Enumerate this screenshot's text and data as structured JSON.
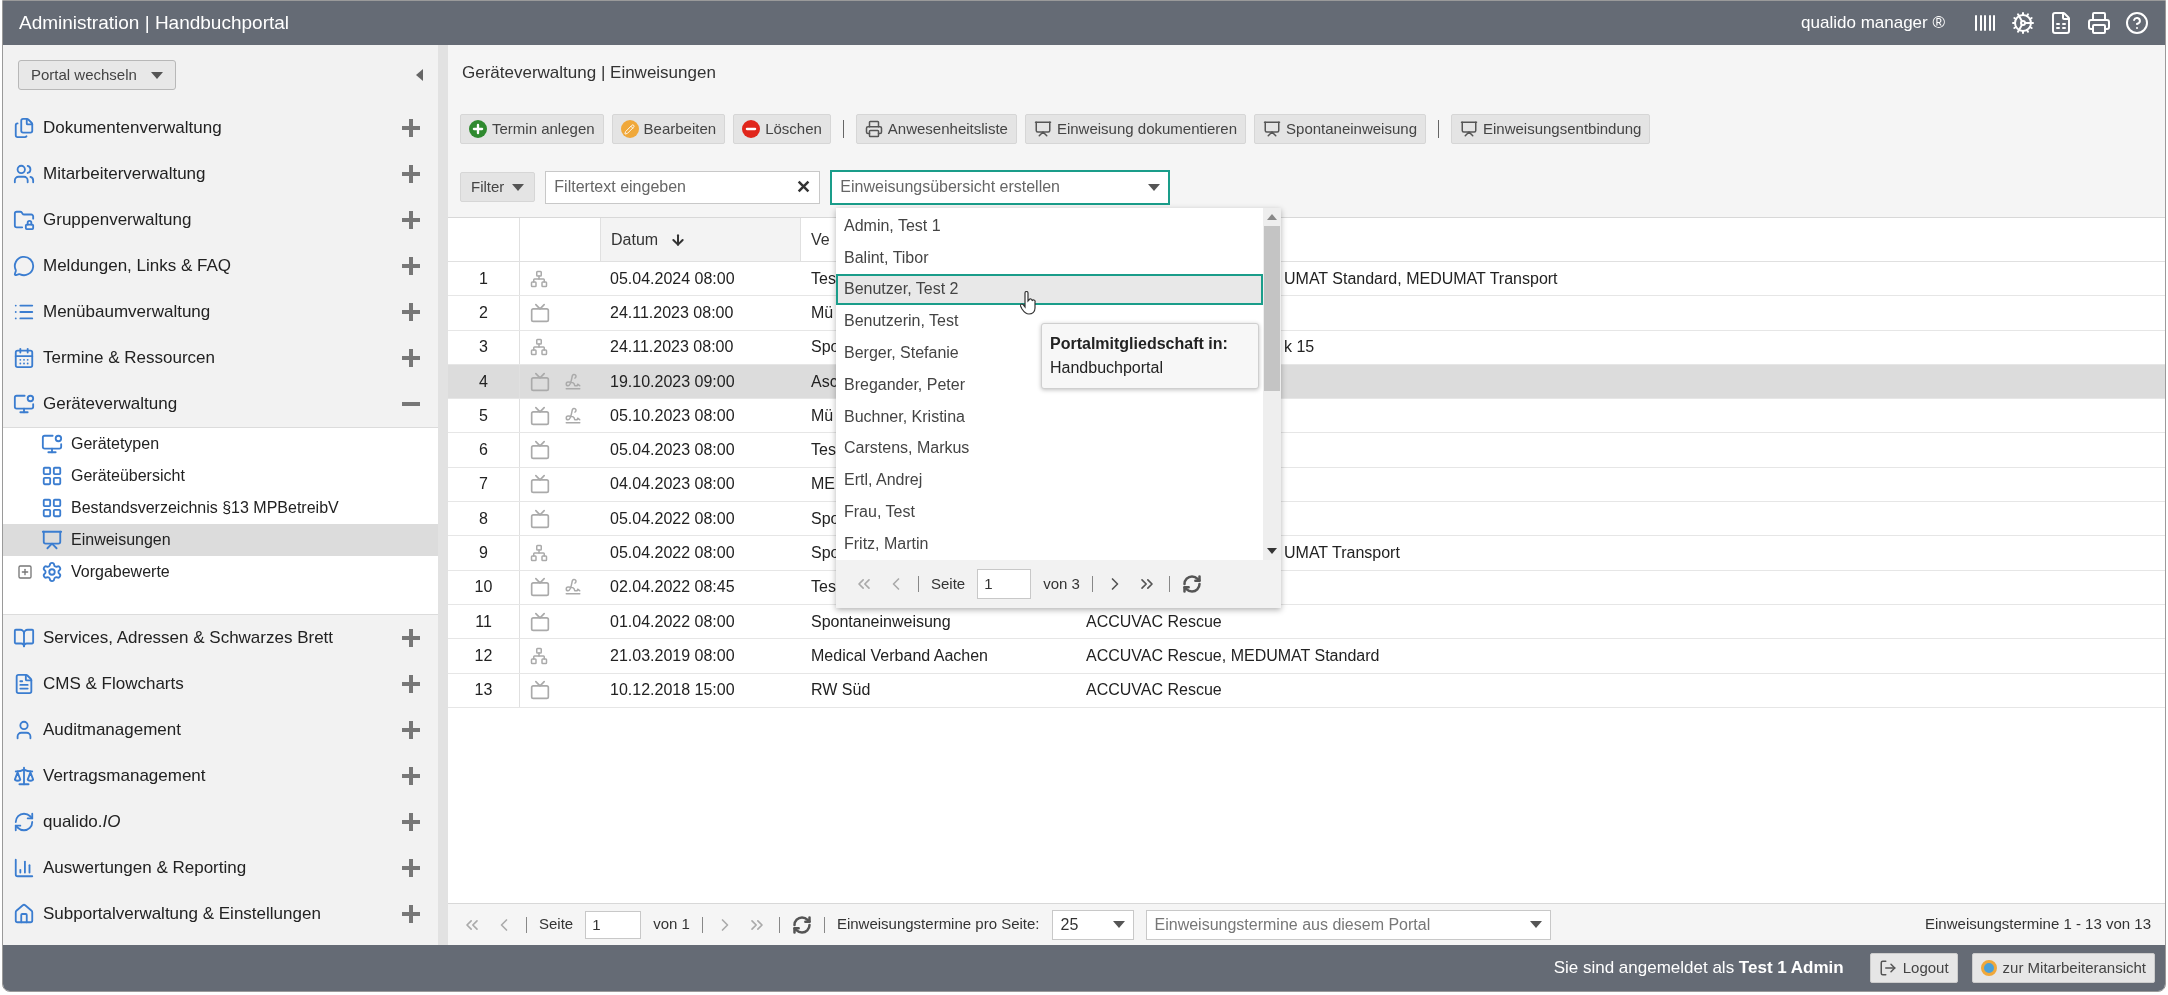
{
  "header": {
    "title": "Administration | Handbuchportal",
    "product": "qualido manager ®"
  },
  "sidebar": {
    "portal_switch": "Portal wechseln",
    "sections_top": [
      {
        "label": "Dokumentenverwaltung",
        "expanded": false
      },
      {
        "label": "Mitarbeiterverwaltung",
        "expanded": false
      },
      {
        "label": "Gruppenverwaltung",
        "expanded": false
      },
      {
        "label": "Meldungen, Links & FAQ",
        "expanded": false
      },
      {
        "label": "Menübaumverwaltung",
        "expanded": false
      },
      {
        "label": "Termine & Ressourcen",
        "expanded": false
      },
      {
        "label": "Geräteverwaltung",
        "expanded": true,
        "children": [
          {
            "label": "Gerätetypen",
            "kind": "page",
            "selected": false
          },
          {
            "label": "Geräteübersicht",
            "kind": "page",
            "selected": false
          },
          {
            "label": "Bestandsverzeichnis §13 MPBetreibV",
            "kind": "page",
            "selected": false
          },
          {
            "label": "Einweisungen",
            "kind": "page",
            "selected": true
          },
          {
            "label": "Vorgabewerte",
            "kind": "folder",
            "selected": false,
            "expanded": false
          }
        ]
      }
    ],
    "sections_bottom": [
      {
        "label": "Services, Adressen & Schwarzes Brett",
        "expanded": false
      },
      {
        "label": "CMS & Flowcharts",
        "expanded": false
      },
      {
        "label": "Auditmanagement",
        "expanded": false
      },
      {
        "label": "Vertragsmanagement",
        "expanded": false
      },
      {
        "label": "qualido.*IO*",
        "expanded": false
      },
      {
        "label": "Auswertungen & Reporting",
        "expanded": false
      },
      {
        "label": "Subportalverwaltung & Einstellungen",
        "expanded": false
      }
    ]
  },
  "content": {
    "title": "Geräteverwaltung | Einweisungen",
    "toolbar": [
      [
        {
          "label": "Termin anlegen",
          "kind": "add"
        },
        {
          "label": "Bearbeiten",
          "kind": "edit"
        },
        {
          "label": "Löschen",
          "kind": "delete"
        }
      ],
      [
        {
          "label": "Anwesenheitsliste",
          "kind": "print"
        },
        {
          "label": "Einweisung dokumentieren",
          "kind": "teach"
        },
        {
          "label": "Spontaneinweisung",
          "kind": "teach"
        }
      ],
      [
        {
          "label": "Einweisungsentbindung",
          "kind": "teach"
        }
      ]
    ],
    "filter": {
      "button": "Filter",
      "placeholder": "Filtertext eingeben",
      "clear": "✕",
      "overview_select": "Einweisungsübersicht erstellen"
    },
    "table": {
      "columns": [
        "Datum",
        "Ve"
      ],
      "rows": [
        {
          "n": "1",
          "kind": "group",
          "signed": false,
          "selected": false,
          "date": "05.04.2024 08:00",
          "column_3": "Tes",
          "column_4_tail": "UMAT Standard, MEDUMAT Transport"
        },
        {
          "n": "2",
          "kind": "device",
          "signed": false,
          "selected": false,
          "date": "24.11.2023 08:00",
          "column_3": "Mü"
        },
        {
          "n": "3",
          "kind": "group",
          "signed": false,
          "selected": false,
          "date": "24.11.2023 08:00",
          "column_3": "Spo",
          "column_4_tail": "k 15"
        },
        {
          "n": "4",
          "kind": "device",
          "signed": true,
          "selected": true,
          "date": "19.10.2023 09:00",
          "column_3": "Asc"
        },
        {
          "n": "5",
          "kind": "device",
          "signed": true,
          "selected": false,
          "date": "05.10.2023 08:00",
          "column_3": "Mü"
        },
        {
          "n": "6",
          "kind": "device",
          "signed": false,
          "selected": false,
          "date": "05.04.2023 08:00",
          "column_3": "Tes"
        },
        {
          "n": "7",
          "kind": "device",
          "signed": false,
          "selected": false,
          "date": "04.04.2023 08:00",
          "column_3": "ME"
        },
        {
          "n": "8",
          "kind": "device",
          "signed": false,
          "selected": false,
          "date": "05.04.2022 08:00",
          "column_3": "Spo"
        },
        {
          "n": "9",
          "kind": "group",
          "signed": false,
          "selected": false,
          "date": "05.04.2022 08:00",
          "column_3": "Spo",
          "column_4_tail": "UMAT Transport"
        },
        {
          "n": "10",
          "kind": "device",
          "signed": true,
          "selected": false,
          "date": "02.04.2022 08:45",
          "column_3": "Tes"
        },
        {
          "n": "11",
          "kind": "device",
          "signed": false,
          "selected": false,
          "date": "01.04.2022 08:00",
          "column_3": "Spontaneinweisung",
          "column_4": "ACCUVAC Rescue"
        },
        {
          "n": "12",
          "kind": "group",
          "signed": false,
          "selected": false,
          "date": "21.03.2019 08:00",
          "column_3": "Medical Verband Aachen",
          "column_4": "ACCUVAC Rescue, MEDUMAT Standard"
        },
        {
          "n": "13",
          "kind": "device",
          "signed": false,
          "selected": false,
          "date": "10.12.2018 15:00",
          "column_3": "RW Süd",
          "column_4": "ACCUVAC Rescue"
        }
      ]
    },
    "dropdown": {
      "items": [
        {
          "label": "Admin, Test 1",
          "selected": false
        },
        {
          "label": "Balint, Tibor",
          "selected": false
        },
        {
          "label": "Benutzer, Test 2",
          "selected": true
        },
        {
          "label": "Benutzerin, Test",
          "selected": false
        },
        {
          "label": "Berger, Stefanie",
          "selected": false
        },
        {
          "label": "Bregander, Peter",
          "selected": false
        },
        {
          "label": "Buchner, Kristina",
          "selected": false
        },
        {
          "label": "Carstens, Markus",
          "selected": false
        },
        {
          "label": "Ertl, Andrej",
          "selected": false
        },
        {
          "label": "Frau, Test",
          "selected": false
        },
        {
          "label": "Fritz, Martin",
          "selected": false
        }
      ],
      "pager": {
        "page_label": "Seite",
        "page": "1",
        "of": "von 3"
      }
    },
    "tooltip": {
      "title": "Portalmitgliedschaft in:",
      "text": "Handbuchportal"
    },
    "pager": {
      "page_label": "Seite",
      "page": "1",
      "of": "von 1",
      "per_page_label": "Einweisungstermine pro Seite:",
      "per_page": "25",
      "scope_placeholder": "Einweisungstermine aus diesem Portal",
      "summary": "Einweisungstermine 1 - 13 von 13"
    }
  },
  "status_bar": {
    "login": "Sie sind angemeldet als **Test 1 Admin**",
    "buttons": [
      "Logout",
      "zur Mitarbeiteransicht"
    ]
  }
}
